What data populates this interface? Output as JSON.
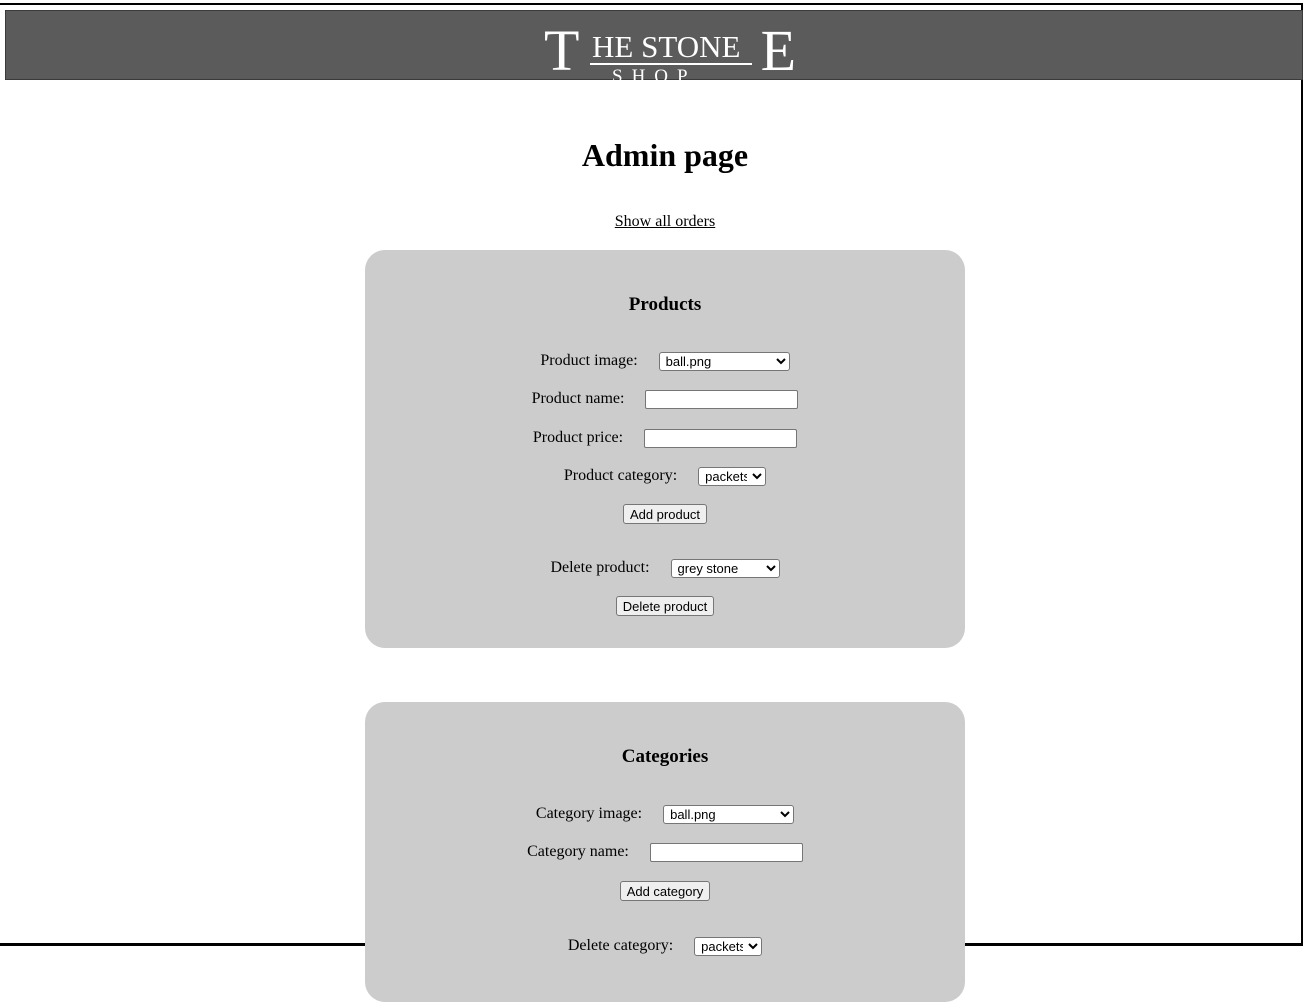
{
  "header": {
    "logo_big_t": "T",
    "logo_top": "HE STONE",
    "logo_bottom": "SHOP",
    "logo_big_e": "E",
    "background_color": "#5b5b5b"
  },
  "page": {
    "title": "Admin page",
    "orders_link": "Show all orders"
  },
  "products": {
    "heading": "Products",
    "image_label": "Product image:",
    "image_selected": "ball.png",
    "name_label": "Product name:",
    "name_value": "",
    "price_label": "Product price:",
    "price_value": "",
    "category_label": "Product category:",
    "category_selected": "packets",
    "add_button": "Add product",
    "delete_label": "Delete product:",
    "delete_selected": "grey stone",
    "delete_button": "Delete product"
  },
  "categories": {
    "heading": "Categories",
    "image_label": "Category image:",
    "image_selected": "ball.png",
    "name_label": "Category name:",
    "name_value": "",
    "add_button": "Add category",
    "delete_label": "Delete category:",
    "delete_selected": "packets"
  },
  "colors": {
    "panel": "#cccccc",
    "header": "#5b5b5b"
  }
}
